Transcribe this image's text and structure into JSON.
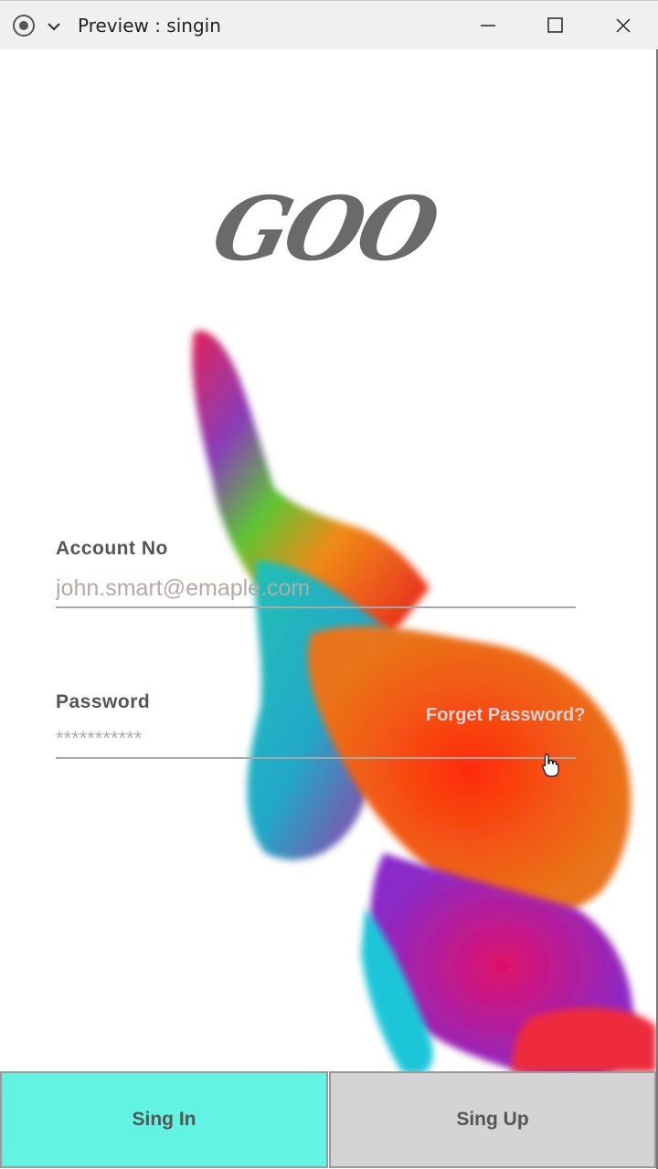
{
  "window": {
    "title": "Preview : singin"
  },
  "icons": {
    "record": "record-icon",
    "chevron": "chevron-down-icon",
    "minimize": "minimize-icon",
    "maximize": "maximize-icon",
    "close": "close-icon",
    "cursor": "hand-cursor-icon"
  },
  "logo": {
    "text": "GOO"
  },
  "form": {
    "account_label": "Account  No",
    "account_placeholder": "john.smart@emaple.com",
    "password_label": "Password",
    "password_placeholder": "***********",
    "forget_link": "Forget Password?"
  },
  "buttons": {
    "signin_label": "Sing In",
    "signup_label": "Sing Up"
  },
  "colors": {
    "signin_bg": "#62f3e2",
    "signup_bg": "#d4d4d4",
    "label": "#555555",
    "placeholder": "#b5a9a6"
  }
}
